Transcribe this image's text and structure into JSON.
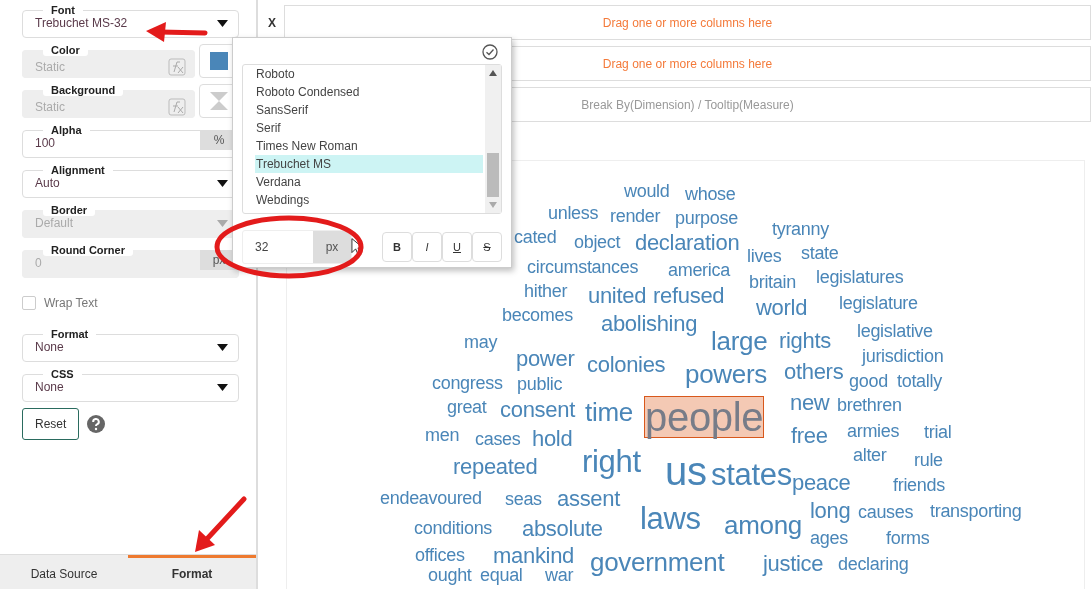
{
  "sidebar": {
    "properties": [
      {
        "kind": "select",
        "label": "Font",
        "value": "Trebuchet MS-32",
        "disabled": false
      },
      {
        "kind": "formula-color",
        "label": "Color",
        "value": "Static",
        "color": "#4a86b8"
      },
      {
        "kind": "formula-pattern",
        "label": "Background",
        "value": "Static"
      },
      {
        "kind": "addon",
        "label": "Alpha",
        "value": "100",
        "unit": "%",
        "disabled": false
      },
      {
        "kind": "select",
        "label": "Alignment",
        "value": "Auto",
        "disabled": false
      },
      {
        "kind": "select",
        "label": "Border",
        "value": "Default",
        "disabled": true
      },
      {
        "kind": "addon",
        "label": "Round Corner",
        "value": "0",
        "unit": "px",
        "disabled": true
      },
      {
        "kind": "checkbox",
        "label": "Wrap Text",
        "checked": false
      },
      {
        "kind": "select",
        "label": "Format",
        "value": "None",
        "disabled": false
      },
      {
        "kind": "select",
        "label": "CSS",
        "value": "None",
        "disabled": false
      },
      {
        "kind": "button",
        "label": "Reset"
      }
    ],
    "tabs": [
      {
        "label": "Data Source",
        "selected": false
      },
      {
        "label": "Format",
        "selected": true
      }
    ]
  },
  "shelves": {
    "x_label": "X",
    "zones": [
      {
        "kind": "empty",
        "text": "Drag one or more columns here"
      },
      {
        "kind": "empty",
        "text": "Drag one or more columns here"
      },
      {
        "kind": "hint",
        "text": "Break By(Dimension) / Tooltip(Measure)"
      }
    ]
  },
  "font_popup": {
    "fonts": [
      {
        "label": "Roboto",
        "selected": false
      },
      {
        "label": "Roboto Condensed",
        "selected": false
      },
      {
        "label": "SansSerif",
        "selected": false
      },
      {
        "label": "Serif",
        "selected": false
      },
      {
        "label": "Times New Roman",
        "selected": false
      },
      {
        "label": "Trebuchet MS",
        "selected": true
      },
      {
        "label": "Verdana",
        "selected": false
      },
      {
        "label": "Webdings",
        "selected": false
      }
    ],
    "size": "32",
    "size_unit": "px",
    "styles": [
      {
        "label": "B",
        "kind": "bold",
        "selected": false
      },
      {
        "label": "I",
        "kind": "italic",
        "selected": false
      },
      {
        "label": "U",
        "kind": "underline",
        "selected": false
      },
      {
        "label": "S",
        "kind": "strike",
        "selected": false
      }
    ]
  },
  "word_cloud": {
    "words": [
      {
        "text": "would",
        "kind": "s",
        "selected": false
      },
      {
        "text": "whose",
        "kind": "s",
        "selected": false
      },
      {
        "text": "unless",
        "kind": "s",
        "selected": false
      },
      {
        "text": "render",
        "kind": "s",
        "selected": false
      },
      {
        "text": "purpose",
        "kind": "s",
        "selected": false
      },
      {
        "text": "cated",
        "kind": "s",
        "selected": false
      },
      {
        "text": "object",
        "kind": "s",
        "selected": false
      },
      {
        "text": "declaration",
        "kind": "m",
        "selected": false
      },
      {
        "text": "tyranny",
        "kind": "s",
        "selected": false
      },
      {
        "text": "lives",
        "kind": "s",
        "selected": false
      },
      {
        "text": "state",
        "kind": "s",
        "selected": false
      },
      {
        "text": "circumstances",
        "kind": "s",
        "selected": false
      },
      {
        "text": "america",
        "kind": "s",
        "selected": false
      },
      {
        "text": "britain",
        "kind": "s",
        "selected": false
      },
      {
        "text": "legislatures",
        "kind": "s",
        "selected": false
      },
      {
        "text": "hither",
        "kind": "s",
        "selected": false
      },
      {
        "text": "united",
        "kind": "m",
        "selected": false
      },
      {
        "text": "refused",
        "kind": "m",
        "selected": false
      },
      {
        "text": "world",
        "kind": "m",
        "selected": false
      },
      {
        "text": "legislature",
        "kind": "s",
        "selected": false
      },
      {
        "text": "becomes",
        "kind": "s",
        "selected": false
      },
      {
        "text": "abolishing",
        "kind": "m",
        "selected": false
      },
      {
        "text": "legislative",
        "kind": "s",
        "selected": false
      },
      {
        "text": "may",
        "kind": "s",
        "selected": false
      },
      {
        "text": "large",
        "kind": "l",
        "selected": false
      },
      {
        "text": "rights",
        "kind": "m",
        "selected": false
      },
      {
        "text": "power",
        "kind": "m",
        "selected": false
      },
      {
        "text": "colonies",
        "kind": "m",
        "selected": false
      },
      {
        "text": "jurisdiction",
        "kind": "s",
        "selected": false
      },
      {
        "text": "powers",
        "kind": "l",
        "selected": false
      },
      {
        "text": "others",
        "kind": "m",
        "selected": false
      },
      {
        "text": "congress",
        "kind": "s",
        "selected": false
      },
      {
        "text": "public",
        "kind": "s",
        "selected": false
      },
      {
        "text": "good",
        "kind": "s",
        "selected": false
      },
      {
        "text": "totally",
        "kind": "s",
        "selected": false
      },
      {
        "text": "great",
        "kind": "s",
        "selected": false
      },
      {
        "text": "consent",
        "kind": "m",
        "selected": false
      },
      {
        "text": "time",
        "kind": "l",
        "selected": false
      },
      {
        "text": "people",
        "kind": "xxl",
        "selected": true
      },
      {
        "text": "new",
        "kind": "m",
        "selected": false
      },
      {
        "text": "brethren",
        "kind": "s",
        "selected": false
      },
      {
        "text": "men",
        "kind": "s",
        "selected": false
      },
      {
        "text": "cases",
        "kind": "s",
        "selected": false
      },
      {
        "text": "hold",
        "kind": "m",
        "selected": false
      },
      {
        "text": "free",
        "kind": "m",
        "selected": false
      },
      {
        "text": "armies",
        "kind": "s",
        "selected": false
      },
      {
        "text": "trial",
        "kind": "s",
        "selected": false
      },
      {
        "text": "repeated",
        "kind": "m",
        "selected": false
      },
      {
        "text": "right",
        "kind": "xl",
        "selected": false
      },
      {
        "text": "us",
        "kind": "xxl",
        "selected": false
      },
      {
        "text": "states",
        "kind": "xl",
        "selected": false
      },
      {
        "text": "alter",
        "kind": "s",
        "selected": false
      },
      {
        "text": "rule",
        "kind": "s",
        "selected": false
      },
      {
        "text": "endeavoured",
        "kind": "s",
        "selected": false
      },
      {
        "text": "seas",
        "kind": "s",
        "selected": false
      },
      {
        "text": "assent",
        "kind": "m",
        "selected": false
      },
      {
        "text": "peace",
        "kind": "m",
        "selected": false
      },
      {
        "text": "friends",
        "kind": "s",
        "selected": false
      },
      {
        "text": "laws",
        "kind": "xl",
        "selected": false
      },
      {
        "text": "among",
        "kind": "l",
        "selected": false
      },
      {
        "text": "long",
        "kind": "m",
        "selected": false
      },
      {
        "text": "causes",
        "kind": "s",
        "selected": false
      },
      {
        "text": "transporting",
        "kind": "s",
        "selected": false
      },
      {
        "text": "conditions",
        "kind": "s",
        "selected": false
      },
      {
        "text": "absolute",
        "kind": "m",
        "selected": false
      },
      {
        "text": "ages",
        "kind": "s",
        "selected": false
      },
      {
        "text": "forms",
        "kind": "s",
        "selected": false
      },
      {
        "text": "offices",
        "kind": "s",
        "selected": false
      },
      {
        "text": "mankind",
        "kind": "m",
        "selected": false
      },
      {
        "text": "government",
        "kind": "l",
        "selected": false
      },
      {
        "text": "justice",
        "kind": "m",
        "selected": false
      },
      {
        "text": "declaring",
        "kind": "s",
        "selected": false
      },
      {
        "text": "ought",
        "kind": "s",
        "selected": false
      },
      {
        "text": "equal",
        "kind": "s",
        "selected": false
      },
      {
        "text": "war",
        "kind": "s",
        "selected": false
      }
    ]
  }
}
